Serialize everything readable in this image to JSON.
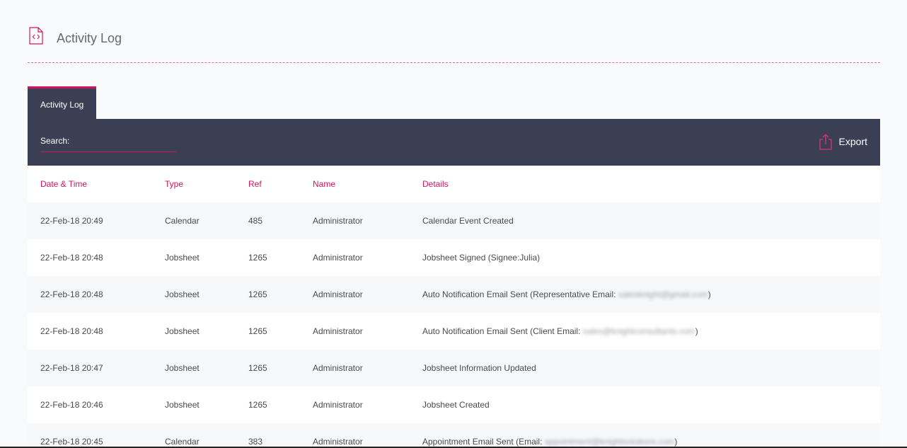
{
  "header": {
    "title": "Activity Log",
    "icon": "code-file-icon"
  },
  "tabs": [
    {
      "label": "Activity Log",
      "active": true
    }
  ],
  "toolbar": {
    "search_label": "Search:",
    "search_value": "",
    "export_label": "Export",
    "export_icon": "export-share-icon"
  },
  "colors": {
    "accent": "#d6145d",
    "toolbar_bg": "#3a3f53",
    "page_bg": "#f9fafc"
  },
  "table": {
    "columns": [
      "Date & Time",
      "Type",
      "Ref",
      "Name",
      "Details"
    ],
    "rows": [
      {
        "date": "22-Feb-18 20:49",
        "type": "Calendar",
        "ref": "485",
        "name": "Administrator",
        "details": "Calendar Event Created",
        "masked": "",
        "suffix": ""
      },
      {
        "date": "22-Feb-18 20:48",
        "type": "Jobsheet",
        "ref": "1265",
        "name": "Administrator",
        "details": "Jobsheet Signed (Signee:Julia)",
        "masked": "",
        "suffix": ""
      },
      {
        "date": "22-Feb-18 20:48",
        "type": "Jobsheet",
        "ref": "1265",
        "name": "Administrator",
        "details": "Auto Notification Email Sent (Representative Email: ",
        "masked": "salesknight@gmail.com",
        "suffix": ")"
      },
      {
        "date": "22-Feb-18 20:48",
        "type": "Jobsheet",
        "ref": "1265",
        "name": "Administrator",
        "details": "Auto Notification Email Sent (Client Email: ",
        "masked": "sales@knightconsultants.com",
        "suffix": ")"
      },
      {
        "date": "22-Feb-18 20:47",
        "type": "Jobsheet",
        "ref": "1265",
        "name": "Administrator",
        "details": "Jobsheet Information Updated",
        "masked": "",
        "suffix": ""
      },
      {
        "date": "22-Feb-18 20:46",
        "type": "Jobsheet",
        "ref": "1265",
        "name": "Administrator",
        "details": "Jobsheet Created",
        "masked": "",
        "suffix": ""
      },
      {
        "date": "22-Feb-18 20:45",
        "type": "Calendar",
        "ref": "383",
        "name": "Administrator",
        "details": "Appointment Email Sent (Email: ",
        "masked": "appointment@knightsolutions.com",
        "suffix": ")"
      }
    ]
  }
}
